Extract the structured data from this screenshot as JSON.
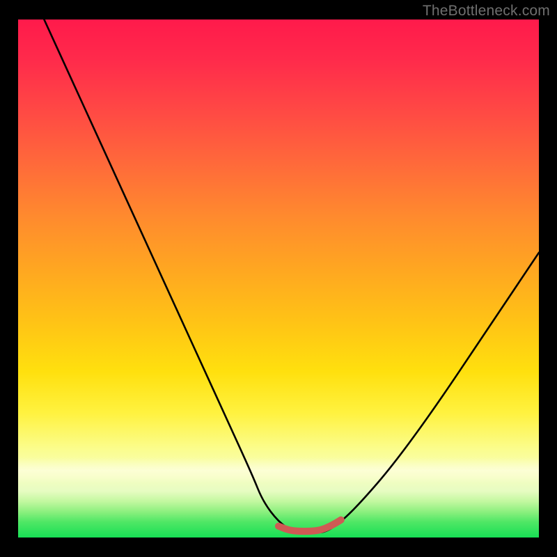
{
  "watermark": "TheBottleneck.com",
  "colors": {
    "gradient_top": "#ff1a4b",
    "gradient_mid": "#ffd400",
    "gradient_bottom": "#17df55",
    "curve": "#000000",
    "accent_segment": "#cf5a54"
  },
  "chart_data": {
    "type": "line",
    "title": "",
    "xlabel": "",
    "ylabel": "",
    "xlim": [
      0,
      100
    ],
    "ylim": [
      0,
      100
    ],
    "grid": false,
    "legend": false,
    "series": [
      {
        "name": "bottleneck-curve",
        "x": [
          5,
          10,
          15,
          20,
          25,
          30,
          35,
          40,
          45,
          47,
          50,
          53,
          55,
          57,
          59,
          62,
          66,
          72,
          80,
          90,
          100
        ],
        "values": [
          100,
          89,
          78,
          67,
          56,
          45,
          34,
          23,
          12,
          7,
          3,
          1,
          1,
          1,
          1,
          3,
          7,
          14,
          25,
          40,
          55
        ]
      },
      {
        "name": "flat-bottom-accent",
        "x": [
          50,
          52,
          54,
          56,
          58,
          60,
          62
        ],
        "values": [
          2.2,
          1.4,
          1.2,
          1.2,
          1.4,
          2.2,
          3.4
        ]
      }
    ],
    "annotations": []
  }
}
